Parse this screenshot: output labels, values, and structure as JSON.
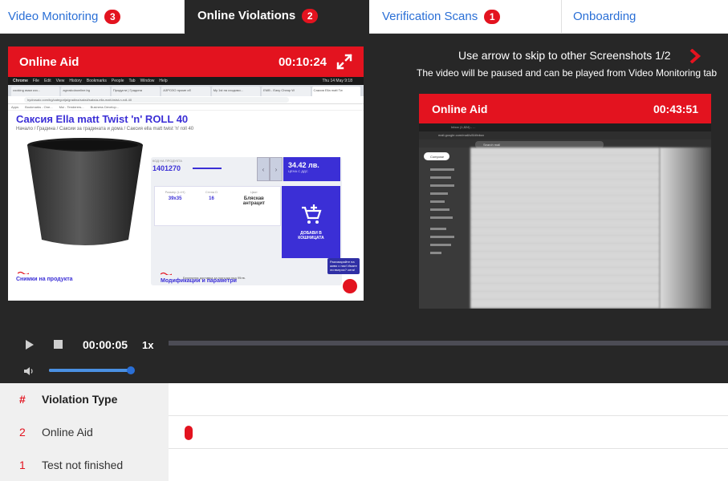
{
  "tabs": [
    {
      "label": "Video Monitoring",
      "count": "3"
    },
    {
      "label": "Online Violations",
      "count": "2"
    },
    {
      "label": "Verification Scans",
      "count": "1"
    },
    {
      "label": "Onboarding"
    }
  ],
  "player": {
    "title": "Online Aid",
    "timestamp": "00:10:24",
    "screenshot": {
      "menu": [
        "Chrome",
        "File",
        "Edit",
        "View",
        "History",
        "Bookmarks",
        "People",
        "Tab",
        "Window",
        "Help"
      ],
      "clock": "Thu 14 May 9:18",
      "browser_tabs": [
        "cooking ямки коз...",
        "agroskolaonline.bg",
        "Продукти | Градина",
        "АЗРОЗО проме об",
        "My 1st на сходимо...",
        "EMB - Easy Cheap W",
        "Саксия Ella matt Tw"
      ],
      "url": "hydrosalo.com/bg/categorija/gradina/saksii/saksia-ella-matt-twist-n-roll-40",
      "bookmarks": [
        "Apps",
        "Bookmarks - One...",
        "Mui - Tenderers...",
        "Business Develop..."
      ],
      "product_title": "Саксия Ella matt Twist 'n' ROLL 40",
      "breadcrumb": "Начало / Градина / Саксии за градината и дома / Саксия ella matt twist 'n' roll 40",
      "code_label": "КОД НА ПРОДУКТА",
      "code": "1401270",
      "price": "34.42 лв.",
      "price_note": "ЦЕНА С ДДС",
      "specs": [
        {
          "label": "Размер (L×H)",
          "value": "39x35"
        },
        {
          "label": "Стена D",
          "value": "16"
        },
        {
          "label": "Цвят",
          "value": "Бляскав антрацит"
        }
      ],
      "cart_label": "ДОБАВИ В КОШНИЦАТА",
      "delivery_note": "Безплатна доставка за поръчки над 99лв.",
      "section_photos": "Снимки на продукта",
      "section_mods": "Модификации и параметри",
      "chat_text": "Разговаряйте на живо с нас! Имате ли въпрос? сега!"
    }
  },
  "hint": {
    "line1": "Use arrow to skip to other Screenshots 1/2",
    "line2": "The video will be paused and can be played from Video Monitoring tab"
  },
  "thumbnail": {
    "title": "Online Aid",
    "timestamp": "00:43:51",
    "screenshot": {
      "tab_label": "Inbox (1,824) - ...",
      "url": "mail.google.com/mail/u/0/#inbox",
      "search_placeholder": "Search mail",
      "compose_label": "Compose"
    }
  },
  "controls": {
    "current_time": "00:00:05",
    "speed": "1x",
    "volume": 0.98
  },
  "table": {
    "headers": {
      "num": "#",
      "type": "Violation Type"
    },
    "rows": [
      {
        "num": "2",
        "type": "Online Aid"
      },
      {
        "num": "1",
        "type": "Test not finished"
      }
    ]
  },
  "colors": {
    "accent_red": "#e3131f",
    "link_blue": "#2a6fd6",
    "dark_bg": "#272727",
    "brand_purple": "#3b2fd6"
  }
}
